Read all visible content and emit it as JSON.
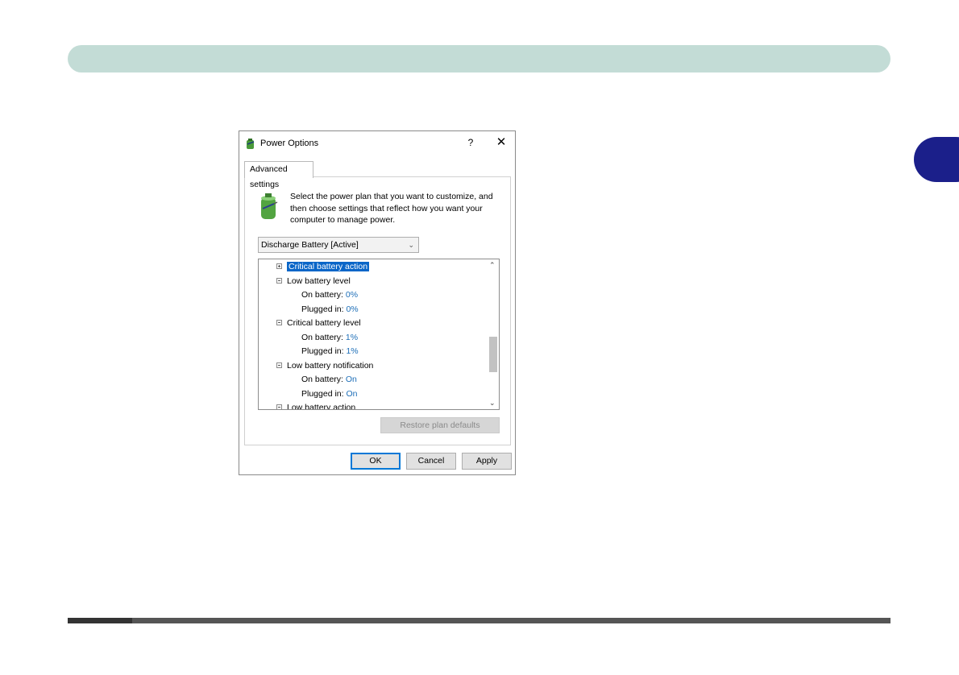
{
  "dialog": {
    "title": "Power Options",
    "help_label": "?",
    "close_label": "✕",
    "tab_label": "Advanced settings",
    "instruction": "Select the power plan that you want to customize, and then choose settings that reflect how you want your computer to manage power.",
    "plan_select_value": "Discharge Battery [Active]",
    "tree": {
      "row0": "Critical battery action",
      "row1": "Low battery level",
      "row2_label": "On battery:",
      "row2_value": "0%",
      "row3_label": "Plugged in:",
      "row3_value": "0%",
      "row4": "Critical battery level",
      "row5_label": "On battery:",
      "row5_value": "1%",
      "row6_label": "Plugged in:",
      "row6_value": "1%",
      "row7": "Low battery notification",
      "row8_label": "On battery:",
      "row8_value": "On",
      "row9_label": "Plugged in:",
      "row9_value": "On",
      "row10": "Low battery action"
    },
    "restore_label": "Restore plan defaults",
    "ok_label": "OK",
    "cancel_label": "Cancel",
    "apply_label": "Apply"
  },
  "colors": {
    "header_bar": "#c3dcd6",
    "side_tab": "#1b1f8a",
    "selection": "#0a66c8",
    "value_text": "#1e6fb8"
  }
}
